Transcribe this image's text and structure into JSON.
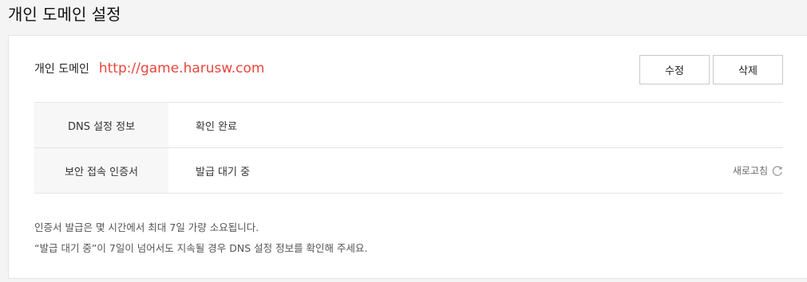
{
  "page": {
    "title": "개인 도메인 설정"
  },
  "domain": {
    "label": "개인 도메인",
    "value": "http://game.harusw.com"
  },
  "actions": {
    "edit_label": "수정",
    "delete_label": "삭제"
  },
  "info_rows": [
    {
      "label": "DNS 설정 정보",
      "value": "확인 완료"
    },
    {
      "label": "보안 접속 인증서",
      "value": "발급 대기 중"
    }
  ],
  "refresh": {
    "label": "새로고침",
    "icon": "refresh-icon"
  },
  "notes": [
    "인증서 발급은 몇 시간에서 최대 7일 가량 소요됩니다.",
    "“발급 대기 중”이 7일이 넘어서도 지속될 경우 DNS 설정 정보를 확인해 주세요."
  ],
  "colors": {
    "domain_value": "#e8453c",
    "label_background": "#f7f7f7",
    "border": "#e4e4e4"
  }
}
